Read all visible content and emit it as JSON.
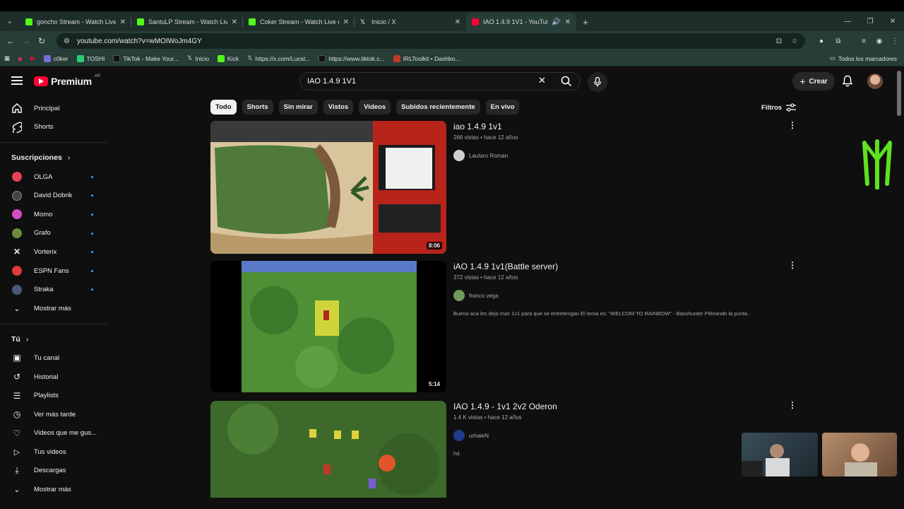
{
  "browser": {
    "tabs": [
      {
        "title": "goncho Stream - Watch Live on Kick",
        "favicon_color": "#53fc18"
      },
      {
        "title": "SantuLP Stream - Watch Live on Kick",
        "favicon_color": "#53fc18"
      },
      {
        "title": "Coker Stream - Watch Live on Kick",
        "favicon_color": "#53fc18"
      },
      {
        "title": "Inicio / X",
        "favicon_color": "#ffffff"
      },
      {
        "title": "IAO 1.4.9 1V1 - YouTube",
        "favicon_color": "#ff0033"
      }
    ],
    "url": "youtube.com/watch?v=wMOIWoJm4GY",
    "bookmarks": [
      "c0ker",
      "TOSHI",
      "TikTok - Make Your...",
      "Inicio",
      "Kick",
      "https://x.com/Lucst...",
      "https://www.tiktok.c...",
      "IRLToolkit • Dashbo..."
    ],
    "all_bookmarks": "Todos los marcadores"
  },
  "header": {
    "logo_text": "Premium",
    "country_code": "AR",
    "search_value": "IAO 1.4.9 1V1",
    "create_label": "Crear"
  },
  "sidebar": {
    "main": [
      {
        "label": "Principal",
        "icon": "home-icon"
      },
      {
        "label": "Shorts",
        "icon": "shorts-icon"
      }
    ],
    "subs_title": "Suscripciones",
    "subscriptions": [
      {
        "label": "OLGA",
        "color": "#e8415a"
      },
      {
        "label": "David Dobrik",
        "color": "#444444"
      },
      {
        "label": "Momo",
        "color": "#d04fc2"
      },
      {
        "label": "Grafo",
        "color": "#6b8b3e"
      },
      {
        "label": "Vorterix",
        "color": "#111111"
      },
      {
        "label": "ESPN Fans",
        "color": "#e03a3e"
      },
      {
        "label": "Straka",
        "color": "#4a5a7a"
      }
    ],
    "show_more": "Mostrar más",
    "you_title": "Tú",
    "you_items": [
      {
        "label": "Tu canal",
        "icon": "channel-icon"
      },
      {
        "label": "Historial",
        "icon": "history-icon"
      },
      {
        "label": "Playlists",
        "icon": "playlists-icon"
      },
      {
        "label": "Ver más tarde",
        "icon": "watch-later-icon"
      },
      {
        "label": "Videos que me gus...",
        "icon": "like-icon"
      },
      {
        "label": "Tus videos",
        "icon": "your-videos-icon"
      },
      {
        "label": "Descargas",
        "icon": "download-icon"
      },
      {
        "label": "Mostrar más",
        "icon": "chevron-down-icon"
      }
    ]
  },
  "chips": [
    "Todo",
    "Shorts",
    "Sin mirar",
    "Vistos",
    "Videos",
    "Subidos recientemente",
    "En vivo"
  ],
  "filters_label": "Filtros",
  "results": [
    {
      "title": "iao 1.4.9 1v1",
      "views": "266 vistas",
      "age": "hace 12 años",
      "channel": "Lautaro Roman",
      "description": "",
      "duration": "8:06"
    },
    {
      "title": "iAO 1.4.9 1v1(Battle server)",
      "views": "372 vistas",
      "age": "hace 12 años",
      "channel": "franco vega",
      "description": "Bueno aca les dejo mas 1v1 para que se entretengan El tema es: \"WELCOM TO RAINBOW\" - Basshunter Péleando la punta..",
      "duration": "5:14"
    },
    {
      "title": "IAO 1.4.9 - 1v1 2v2 Oderon",
      "views": "1.4 K vistas",
      "age": "hace 12 años",
      "channel": "urhaieN",
      "description": "hd.",
      "duration": ""
    }
  ]
}
